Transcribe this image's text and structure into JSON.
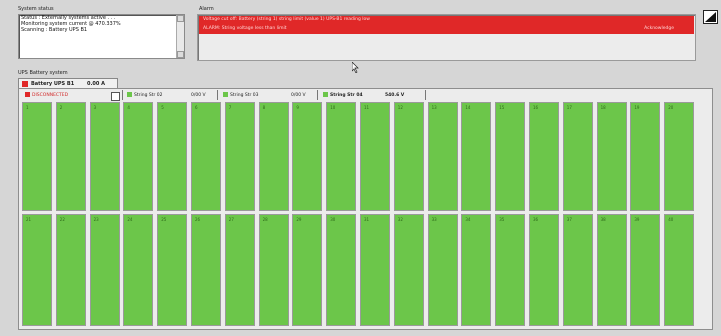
{
  "status": {
    "group_label": "System status",
    "lines": [
      "Status : Externally systems active . . .",
      "Monitoring system current @ 470.337%",
      "Scanning : Battery UPS B1"
    ]
  },
  "alarms": {
    "group_label": "Alarm",
    "rows": [
      {
        "text": "Voltage cut off: Battery (string 1) string limit (value 1) UPS-B1 reading low"
      },
      {
        "text": "ALARM: String voltage less than limit"
      }
    ],
    "ack_label": "Acknowledge"
  },
  "battery": {
    "group_label": "UPS Battery system",
    "tab": {
      "label": "Battery UPS B1",
      "value": "0.00 A"
    }
  },
  "strip": {
    "disconnected": "DISCONNECTED",
    "string1": {
      "label": "String Str 02",
      "value": "0/00 V"
    },
    "string2": {
      "label": "String Str 03",
      "value": "0/00 V"
    },
    "string3": {
      "label": "String Str 04",
      "value": "540.6 V"
    }
  },
  "cells": {
    "top": [
      "1",
      "2",
      "3",
      "4",
      "5",
      "6",
      "7",
      "8",
      "9",
      "10",
      "11",
      "12",
      "13",
      "14",
      "15",
      "16",
      "17",
      "18",
      "19",
      "20"
    ],
    "bottom": [
      "21",
      "22",
      "23",
      "24",
      "25",
      "26",
      "27",
      "28",
      "29",
      "30",
      "31",
      "32",
      "33",
      "34",
      "35",
      "36",
      "37",
      "38",
      "39",
      "40"
    ]
  },
  "colors": {
    "cell_ok": "#6cc64a",
    "alarm": "#e02828",
    "disconnected": "#e02828"
  },
  "icons": [
    "cursor-icon",
    "resize-corner-icon",
    "scroll-up-icon",
    "scroll-down-icon"
  ]
}
